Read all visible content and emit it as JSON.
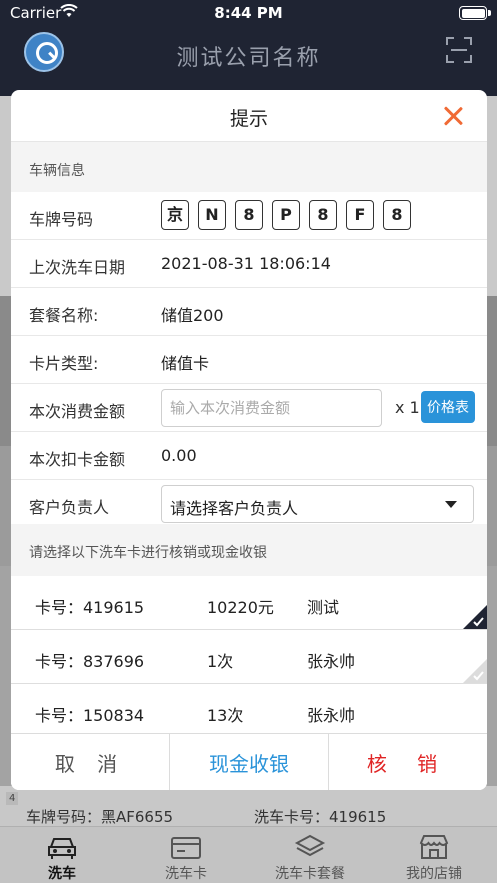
{
  "status_bar": {
    "carrier": "Carrier",
    "time": "8:44 PM"
  },
  "app": {
    "title": "测试公司名称"
  },
  "background_record": {
    "index": "4",
    "plate": "车牌号码：黑AF6655",
    "card": "洗车卡号：419615"
  },
  "tabbar": [
    {
      "label": "洗车",
      "icon": "car-icon",
      "active": true
    },
    {
      "label": "洗车卡",
      "icon": "card-icon",
      "active": false
    },
    {
      "label": "洗车卡套餐",
      "icon": "layers-icon",
      "active": false
    },
    {
      "label": "我的店铺",
      "icon": "shop-icon",
      "active": false
    }
  ],
  "dialog": {
    "title": "提示",
    "vehicle_section": "车辆信息",
    "plate_label": "车牌号码",
    "plate_chars": [
      "京",
      "N",
      "8",
      "P",
      "8",
      "F",
      "8"
    ],
    "last_wash_label": "上次洗车日期",
    "last_wash_value": "2021-08-31 18:06:14",
    "package_label": "套餐名称:",
    "package_value": "储值200",
    "card_type_label": "卡片类型:",
    "card_type_value": "储值卡",
    "amount_label": "本次消费金额",
    "amount_placeholder": "输入本次消费金额",
    "amount_value": "",
    "multiplier": "x 1",
    "price_button": "价格表",
    "deduct_label": "本次扣卡金额",
    "deduct_value": "0.00",
    "owner_label": "客户负责人",
    "owner_select": "请选择客户负责人",
    "card_hint": "请选择以下洗车卡进行核销或现金收银",
    "cards": [
      {
        "no": "卡号：419615",
        "amount": "10220元",
        "owner": "测试",
        "selected": true
      },
      {
        "no": "卡号：837696",
        "amount": "1次",
        "owner": "张永帅",
        "selected": false
      },
      {
        "no": "卡号：150834",
        "amount": "13次",
        "owner": "张永帅",
        "selected": false
      }
    ],
    "cancel_label": "取 消",
    "cash_label": "现金收银",
    "verify_label": "核 销"
  },
  "colors": {
    "accent": "#2a93d9",
    "danger": "#e02525",
    "close": "#f06a35",
    "header": "#1f2433"
  }
}
